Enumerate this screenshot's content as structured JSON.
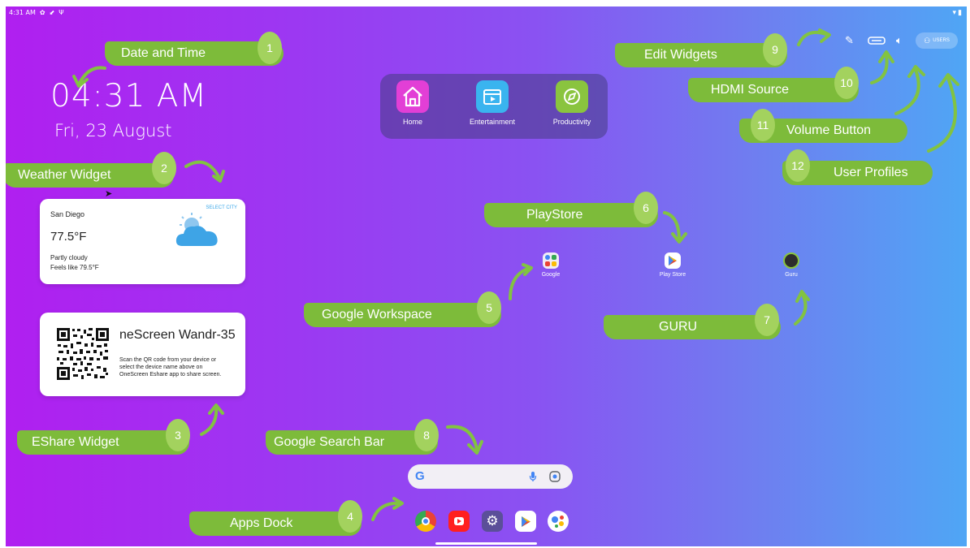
{
  "status_bar": {
    "time": "4:31 AM"
  },
  "clock": {
    "time": "04:31 AM",
    "date": "Fri, 23 August"
  },
  "weather": {
    "city": "San Diego",
    "select_city": "SELECT CITY",
    "temperature": "77.5°F",
    "condition": "Partly cloudy",
    "feels_like": "Feels like 79.5°F"
  },
  "eshare": {
    "device_name": "neScreen Wandr-35",
    "instructions": [
      "Scan the QR code from your device or",
      "select  the device  name above on",
      "OneScreen Eshare app to share screen."
    ]
  },
  "modes": [
    {
      "label": "Home",
      "icon": "home-icon",
      "color": "#e040d8"
    },
    {
      "label": "Entertainment",
      "icon": "film-icon",
      "color": "#3ab4ef"
    },
    {
      "label": "Productivity",
      "icon": "compass-icon",
      "color": "#8ac43f"
    }
  ],
  "apps": [
    {
      "label": "Google",
      "icon": "google-folder-icon"
    },
    {
      "label": "Play Store",
      "icon": "play-store-icon"
    },
    {
      "label": "Guru",
      "icon": "guru-icon"
    }
  ],
  "top_bar": {
    "users_label": "USERS"
  },
  "dock": [
    {
      "name": "Chrome",
      "icon": "chrome-icon",
      "color": "#e34133"
    },
    {
      "name": "YouTube",
      "icon": "youtube-icon",
      "color": "#ff2020"
    },
    {
      "name": "Settings",
      "icon": "settings-icon",
      "color": "#6a5fa8"
    },
    {
      "name": "Play Store",
      "icon": "play-store-icon",
      "color": "#ffffff"
    },
    {
      "name": "Assistant",
      "icon": "assistant-icon",
      "color": "#ffffff"
    }
  ],
  "callouts": [
    {
      "num": "1",
      "label": "Date and Time"
    },
    {
      "num": "2",
      "label": "Weather Widget"
    },
    {
      "num": "3",
      "label": "EShare Widget"
    },
    {
      "num": "4",
      "label": "Apps Dock"
    },
    {
      "num": "5",
      "label": "Google Workspace"
    },
    {
      "num": "6",
      "label": "PlayStore"
    },
    {
      "num": "7",
      "label": "GURU"
    },
    {
      "num": "8",
      "label": "Google Search Bar"
    },
    {
      "num": "9",
      "label": "Edit Widgets"
    },
    {
      "num": "10",
      "label": "HDMI Source"
    },
    {
      "num": "11",
      "label": "Volume Button"
    },
    {
      "num": "12",
      "label": "User Profiles"
    }
  ],
  "colors": {
    "callout_green": "#7dbb3a",
    "callout_badge": "#a3d25e"
  }
}
